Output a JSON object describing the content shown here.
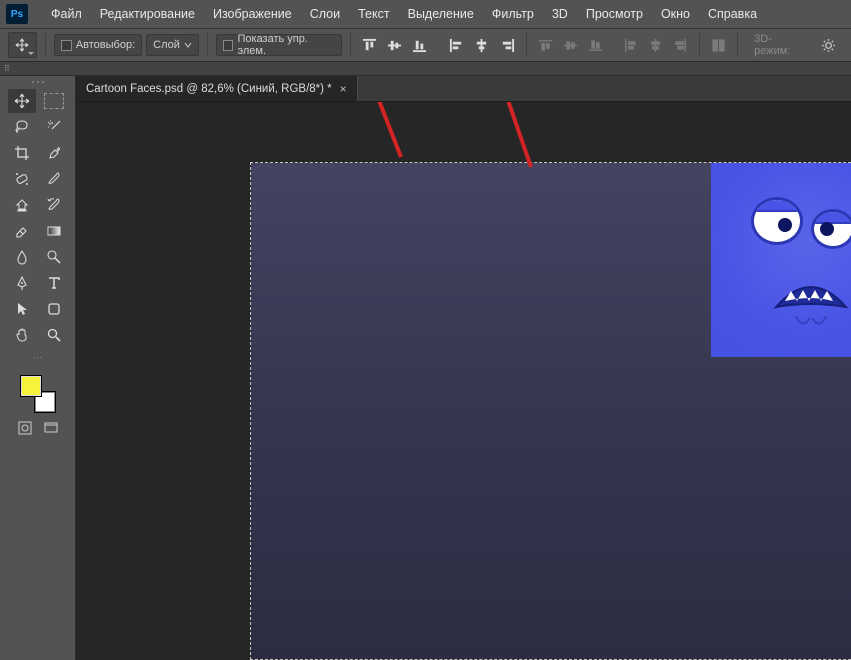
{
  "app": {
    "logo": "Ps"
  },
  "menu": {
    "items": [
      "Файл",
      "Редактирование",
      "Изображение",
      "Слои",
      "Текст",
      "Выделение",
      "Фильтр",
      "3D",
      "Просмотр",
      "Окно",
      "Справка"
    ]
  },
  "options": {
    "autoselect_label": "Автовыбор:",
    "target_dropdown": "Слой",
    "show_transform_label": "Показать упр. элем.",
    "mode3d_label": "3D-режим:",
    "align_buttons": [
      {
        "name": "align-top",
        "d": "top"
      },
      {
        "name": "align-vcenter",
        "d": "vcenter"
      },
      {
        "name": "align-bottom",
        "d": "bottom"
      },
      {
        "name": "align-left",
        "d": "left"
      },
      {
        "name": "align-hcenter",
        "d": "hcenter"
      },
      {
        "name": "align-right",
        "d": "right"
      }
    ],
    "distribute_buttons": [
      {
        "name": "distribute-top"
      },
      {
        "name": "distribute-vcenter"
      },
      {
        "name": "distribute-bottom"
      },
      {
        "name": "distribute-left"
      },
      {
        "name": "distribute-hcenter"
      },
      {
        "name": "distribute-right"
      }
    ]
  },
  "document": {
    "tab_title": "Cartoon Faces.psd @ 82,6% (Синий, RGB/8*) *"
  },
  "swatches": {
    "foreground": "#f5f33a",
    "background": "#ffffff"
  },
  "toolbox_rows": [
    [
      "move",
      "marquee"
    ],
    [
      "lasso",
      "magic-wand"
    ],
    [
      "crop",
      "eyedropper"
    ],
    [
      "spot-heal",
      "brush"
    ],
    [
      "clone",
      "history-brush"
    ],
    [
      "eraser",
      "gradient"
    ],
    [
      "blur",
      "dodge"
    ],
    [
      "pen",
      "type"
    ],
    [
      "path-select",
      "shape"
    ],
    [
      "hand",
      "zoom"
    ]
  ]
}
